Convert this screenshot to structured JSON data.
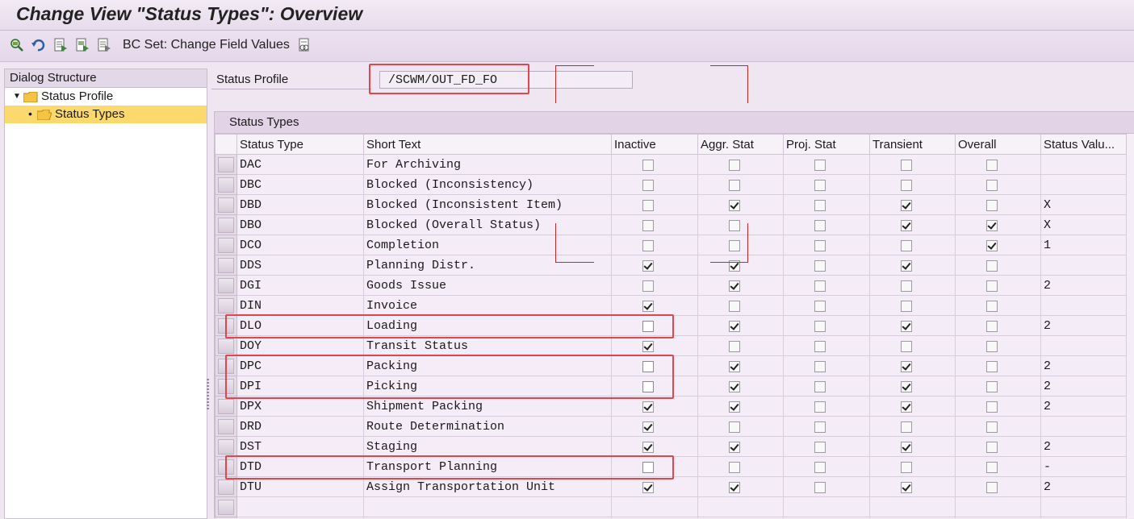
{
  "window": {
    "title": "Change View \"Status Types\": Overview"
  },
  "toolbar": {
    "icons": [
      "display-change-icon",
      "undo-icon",
      "select-all-icon",
      "select-block-icon",
      "deselect-icon",
      "bc-set-icon"
    ],
    "bc_set_label": "BC Set: Change Field Values"
  },
  "dialog_structure": {
    "header": "Dialog Structure",
    "items": [
      {
        "label": "Status Profile",
        "level": 0,
        "expanded": true,
        "selected": false
      },
      {
        "label": "Status Types",
        "level": 1,
        "expanded": false,
        "selected": true
      }
    ]
  },
  "status_profile": {
    "label": "Status Profile",
    "value": "/SCWM/OUT_FD_FO"
  },
  "grid": {
    "title": "Status Types",
    "columns": [
      "Status Type",
      "Short Text",
      "Inactive",
      "Aggr. Stat",
      "Proj. Stat",
      "Transient",
      "Overall",
      "Status Valu..."
    ],
    "rows": [
      {
        "type": "DAC",
        "text": "For Archiving",
        "inactive": false,
        "aggr": false,
        "proj": false,
        "transient": false,
        "overall": false,
        "value": ""
      },
      {
        "type": "DBC",
        "text": "Blocked (Inconsistency)",
        "inactive": false,
        "aggr": false,
        "proj": false,
        "transient": false,
        "overall": false,
        "value": ""
      },
      {
        "type": "DBD",
        "text": "Blocked (Inconsistent Item)",
        "inactive": false,
        "aggr": true,
        "proj": false,
        "transient": true,
        "overall": false,
        "value": "X"
      },
      {
        "type": "DBO",
        "text": "Blocked (Overall Status)",
        "inactive": false,
        "aggr": false,
        "proj": false,
        "transient": true,
        "overall": true,
        "value": "X"
      },
      {
        "type": "DCO",
        "text": "Completion",
        "inactive": false,
        "aggr": false,
        "proj": false,
        "transient": false,
        "overall": true,
        "value": "1"
      },
      {
        "type": "DDS",
        "text": "Planning Distr.",
        "inactive": true,
        "aggr": true,
        "proj": false,
        "transient": true,
        "overall": false,
        "value": ""
      },
      {
        "type": "DGI",
        "text": "Goods Issue",
        "inactive": false,
        "aggr": true,
        "proj": false,
        "transient": false,
        "overall": false,
        "value": "2"
      },
      {
        "type": "DIN",
        "text": "Invoice",
        "inactive": true,
        "aggr": false,
        "proj": false,
        "transient": false,
        "overall": false,
        "value": ""
      },
      {
        "type": "DLO",
        "text": "Loading",
        "inactive": false,
        "aggr": true,
        "proj": false,
        "transient": true,
        "overall": false,
        "value": "2"
      },
      {
        "type": "DOY",
        "text": "Transit Status",
        "inactive": true,
        "aggr": false,
        "proj": false,
        "transient": false,
        "overall": false,
        "value": ""
      },
      {
        "type": "DPC",
        "text": "Packing",
        "inactive": false,
        "aggr": true,
        "proj": false,
        "transient": true,
        "overall": false,
        "value": "2"
      },
      {
        "type": "DPI",
        "text": "Picking",
        "inactive": false,
        "aggr": true,
        "proj": false,
        "transient": true,
        "overall": false,
        "value": "2"
      },
      {
        "type": "DPX",
        "text": "Shipment Packing",
        "inactive": true,
        "aggr": true,
        "proj": false,
        "transient": true,
        "overall": false,
        "value": "2"
      },
      {
        "type": "DRD",
        "text": "Route Determination",
        "inactive": true,
        "aggr": false,
        "proj": false,
        "transient": false,
        "overall": false,
        "value": ""
      },
      {
        "type": "DST",
        "text": "Staging",
        "inactive": true,
        "aggr": true,
        "proj": false,
        "transient": true,
        "overall": false,
        "value": "2"
      },
      {
        "type": "DTD",
        "text": "Transport Planning",
        "inactive": false,
        "aggr": false,
        "proj": false,
        "transient": false,
        "overall": false,
        "value": "-"
      },
      {
        "type": "DTU",
        "text": "Assign Transportation Unit",
        "inactive": true,
        "aggr": true,
        "proj": false,
        "transient": true,
        "overall": false,
        "value": "2"
      }
    ],
    "highlighted_rows": [
      "DLO",
      "DPC",
      "DPI",
      "DTD"
    ],
    "highlight_color": "#e0474c"
  }
}
